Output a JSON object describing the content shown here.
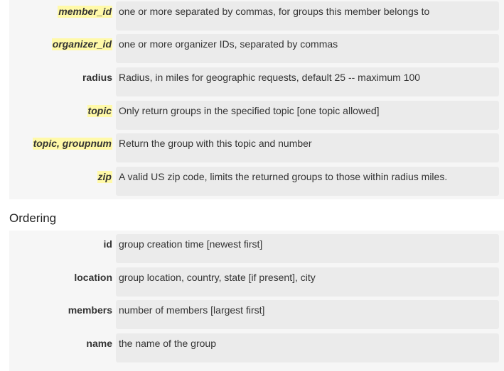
{
  "params": [
    {
      "name": "member_id",
      "highlighted": true,
      "description": "one or more separated by commas, for groups this member belongs to"
    },
    {
      "name": "organizer_id",
      "highlighted": true,
      "description": "one or more organizer IDs, separated by commas"
    },
    {
      "name": "radius",
      "highlighted": false,
      "description": "Radius, in miles for geographic requests, default 25 -- maximum 100"
    },
    {
      "name": "topic",
      "highlighted": true,
      "description": "Only return groups in the specified topic [one topic allowed]"
    },
    {
      "name": "topic, groupnum",
      "highlighted": true,
      "description": "Return the group with this topic and number"
    },
    {
      "name": "zip",
      "highlighted": true,
      "description": "A valid US zip code, limits the returned groups to those within radius miles."
    }
  ],
  "ordering": {
    "heading": "Ordering",
    "items": [
      {
        "name": "id",
        "highlighted": false,
        "description": "group creation time [newest first]"
      },
      {
        "name": "location",
        "highlighted": false,
        "description": "group location, country, state [if present], city"
      },
      {
        "name": "members",
        "highlighted": false,
        "description": "number of members [largest first]"
      },
      {
        "name": "name",
        "highlighted": false,
        "description": "the name of the group"
      }
    ]
  },
  "colors": {
    "highlight": "#fff9a8",
    "panel": "#f6f6f6",
    "value_box": "#ebebeb"
  }
}
